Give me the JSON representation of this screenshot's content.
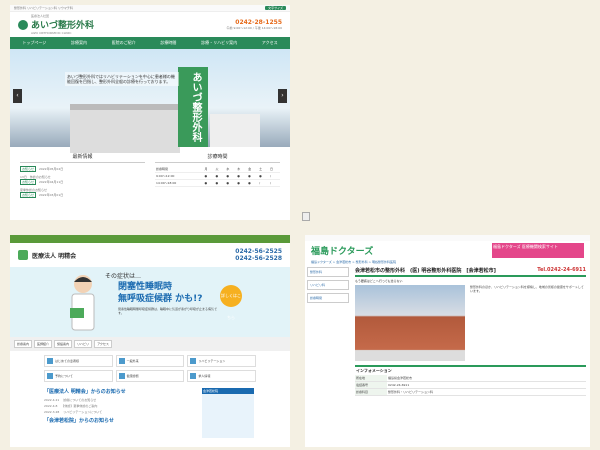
{
  "shot1": {
    "topbar_left": "整形外科 リハビリテーション科 リウマチ科",
    "topbar_button": "文字サイズ",
    "logo_pre": "医療法人社団",
    "logo_name": "あいづ整形外科",
    "logo_sub": "AIZU ORTHOPAEDIC CLINIC",
    "tel": "0242-28-1255",
    "hours_line": "午前 9:00〜12:00 / 午後 14:00〜18:00",
    "nav": [
      "トップページ",
      "診療案内",
      "医院のご紹介",
      "診療時間",
      "診療・リハビリ案内",
      "アクセス"
    ],
    "hero_copy": "あいづ整形外科ではリハビリテーションを中心に患者様の機能回復を目指し、整形外科全般の診療を行っております。",
    "hero_sign": "あいづ整形外科",
    "news_title": "最新情報",
    "news": [
      {
        "tag": "お知らせ",
        "date": "2022年05月02日",
        "text": "13日　休診のお知らせ"
      },
      {
        "tag": "お知らせ",
        "date": "2022年04月11日",
        "text": "夏季休診のお知らせ"
      },
      {
        "tag": "お知らせ",
        "date": "2022年03月01日",
        "text": ""
      }
    ],
    "hours_title": "診療時間",
    "hours_head": [
      "診療時間",
      "月",
      "火",
      "水",
      "木",
      "金",
      "土",
      "日"
    ],
    "hours_rows": [
      {
        "time": "9:00〜12:00",
        "marks": [
          "●",
          "●",
          "●",
          "●",
          "●",
          "●",
          "/"
        ]
      },
      {
        "time": "14:00〜18:00",
        "marks": [
          "●",
          "●",
          "●",
          "●",
          "●",
          "/",
          "/"
        ]
      }
    ]
  },
  "shot2": {
    "brand_name": "医療法人 明精会",
    "tel1": "0242-56-2525",
    "tel2": "0242-56-2528",
    "hero_lead": "その症状は…",
    "hero_title1": "閉塞性睡眠時",
    "hero_title2": "無呼吸症候群 かも!?",
    "hero_text": "閉塞性睡眠時無呼吸症候群は、睡眠中に気道が塞がり呼吸が止まる病気です。",
    "badge": "詳しくはこちら",
    "tabs": [
      "診療案内",
      "医師紹介",
      "施設案内",
      "リハビリ",
      "アクセス"
    ],
    "links": [
      "はじめての患者様",
      "一般外来",
      "リハビリテーション",
      "予約について",
      "健康診断",
      "求人情報"
    ],
    "news_title": "「医療法人 明精会」からのお知らせ",
    "news": [
      {
        "date": "2022.4.21",
        "text": "診療についてのお知らせ"
      },
      {
        "date": "2022.4.8",
        "text": "【休診】夏季休診のご案内"
      },
      {
        "date": "2022.3.28",
        "text": "リハビリテーションについて"
      }
    ],
    "news2_title": "「会津若松院」からのお知らせ",
    "side_title": "会津若松院"
  },
  "shot3": {
    "logo": "福島ドクターズ",
    "banner": "福島ドクターズ 医療機関検索サイト",
    "crumb": "福島ドクターズ > 会津若松市 > 整形外科 > 明谷整形外科医院",
    "title": "会津若松市の整形外科　(医) 明谷整形外科医院　[会津若松市]",
    "phone": "Tel.0242-24-6911",
    "subtitle": "もう腰痛はどこへ行っても治らない",
    "desc": "整形外科のほか、リハビリテーション科を標榜し、地域の皆様の健康をサポートしています。",
    "sidebar": [
      "整形外科",
      "リハビリ科",
      "診療時間"
    ],
    "table_title": "インフォメーション",
    "table": [
      {
        "label": "所在地",
        "value": "福島県会津若松市"
      },
      {
        "label": "電話番号",
        "value": "0242-24-6911"
      },
      {
        "label": "診療科目",
        "value": "整形外科・リハビリテーション科"
      }
    ]
  }
}
